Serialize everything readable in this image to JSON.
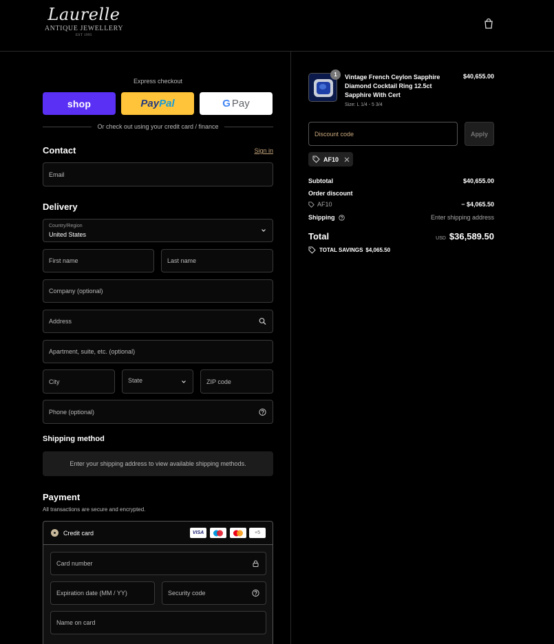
{
  "header": {
    "logo_script": "Laurelle",
    "logo_sub": "ANTIQUE JEWELLERY",
    "logo_est": "EST 1995"
  },
  "express": {
    "title": "Express checkout",
    "shop_label": "shop",
    "paypal_a": "Pay",
    "paypal_b": "Pal",
    "gpay_g": "G",
    "gpay_label": "Pay",
    "or_text": "Or check out using your credit card / finance"
  },
  "contact": {
    "title": "Contact",
    "signin": "Sign in",
    "email_placeholder": "Email"
  },
  "delivery": {
    "title": "Delivery",
    "country_label": "Country/Region",
    "country_value": "United States",
    "first_name": "First name",
    "last_name": "Last name",
    "company": "Company (optional)",
    "address": "Address",
    "apartment": "Apartment, suite, etc. (optional)",
    "city": "City",
    "state": "State",
    "zip": "ZIP code",
    "phone": "Phone (optional)"
  },
  "shipping_method": {
    "title": "Shipping method",
    "message": "Enter your shipping address to view available shipping methods."
  },
  "payment": {
    "title": "Payment",
    "subtitle": "All transactions are secure and encrypted.",
    "method_label": "Credit card",
    "card_visa": "VISA",
    "card_more": "+5",
    "card_number": "Card number",
    "expiration": "Expiration date (MM / YY)",
    "security_code": "Security code",
    "name_on_card": "Name on card"
  },
  "order": {
    "product_name": "Vintage French Ceylon Sapphire Diamond Cocktail Ring 12.5ct Sapphire With Cert",
    "product_variant": "Size: L 1/4 - 5 3/4",
    "product_price": "$40,655.00",
    "quantity": "1",
    "discount_placeholder": "Discount code",
    "apply_label": "Apply",
    "applied_code": "AF10",
    "subtotal_label": "Subtotal",
    "subtotal_value": "$40,655.00",
    "order_discount_label": "Order discount",
    "discount_code": "AF10",
    "discount_value": "− $4,065.50",
    "shipping_label": "Shipping",
    "shipping_value": "Enter shipping address",
    "total_label": "Total",
    "currency": "USD",
    "total_value": "$36,589.50",
    "savings_label": "TOTAL SAVINGS",
    "savings_value": "$4,065.50"
  },
  "colors": {
    "accent": "#c8a77d",
    "shop_pay": "#5a31f4",
    "paypal": "#ffc439"
  }
}
